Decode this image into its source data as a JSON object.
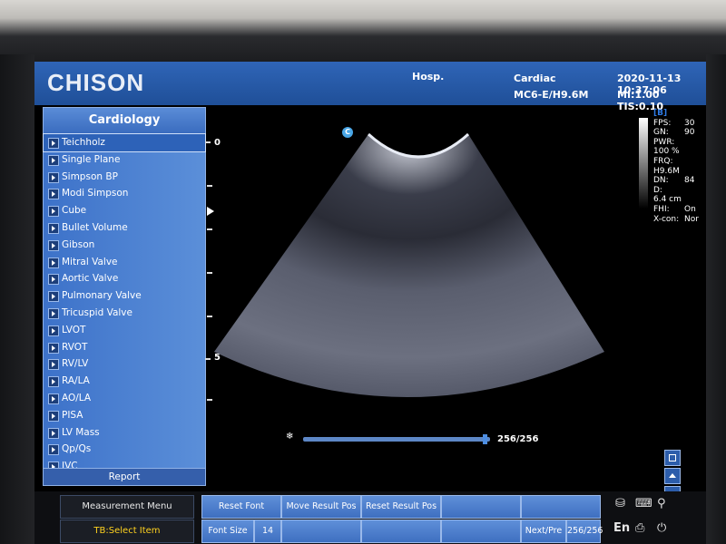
{
  "header": {
    "brand": "CHISON",
    "hospital": "Hosp.",
    "exam": "Cardiac",
    "probe_preset": "MC6-E/H9.6M",
    "datetime": "2020-11-13 10:37:06",
    "indices": "MI:1.00  TIS:0.10"
  },
  "menu": {
    "title": "Cardiology",
    "items": [
      {
        "label": "Teichholz"
      },
      {
        "label": "Single Plane"
      },
      {
        "label": "Simpson BP"
      },
      {
        "label": "Modi Simpson"
      },
      {
        "label": "Cube"
      },
      {
        "label": "Bullet Volume"
      },
      {
        "label": "Gibson"
      },
      {
        "label": "Mitral Valve"
      },
      {
        "label": "Aortic Valve"
      },
      {
        "label": "Pulmonary Valve"
      },
      {
        "label": "Tricuspid Valve"
      },
      {
        "label": "LVOT"
      },
      {
        "label": "RVOT"
      },
      {
        "label": "RV/LV"
      },
      {
        "label": "RA/LA"
      },
      {
        "label": "AO/LA"
      },
      {
        "label": "PISA"
      },
      {
        "label": "LV Mass"
      },
      {
        "label": "Qp/Qs"
      },
      {
        "label": "IVC"
      }
    ],
    "active_index": 0,
    "report_label": "Report"
  },
  "depth_scale": {
    "top_label": "0",
    "mid_label": "5"
  },
  "orientation_marker": "C",
  "imaging_params": {
    "mode": "[B]",
    "rows": [
      {
        "key": "FPS:",
        "value": "30"
      },
      {
        "key": "GN:",
        "value": "90"
      },
      {
        "key": "PWR:",
        "value": "100 %"
      },
      {
        "key": "FRQ:",
        "value": "H9.6M"
      },
      {
        "key": "DN:",
        "value": "84"
      },
      {
        "key": "D:",
        "value": "6.4 cm"
      },
      {
        "key": "FHI:",
        "value": "On"
      },
      {
        "key": "X-con:",
        "value": "Nor"
      }
    ]
  },
  "cine": {
    "count": "256/256",
    "position_fraction": 1.0
  },
  "bottom_bar": {
    "measurement_menu": "Measurement Menu",
    "tb_select": "TB:Select Item",
    "buttons_top": [
      "Reset Font",
      "Move Result Pos",
      "Reset Result Pos",
      "",
      ""
    ],
    "font_size_label": "Font Size",
    "font_size_value": "14",
    "buttons_bottom_blank": [
      "",
      ""
    ],
    "next_pre_label": "Next/Pre",
    "next_pre_value": "256/256",
    "lang": "En"
  },
  "colors": {
    "header_blue": "#2a5db0",
    "menu_blue": "#4a80d1",
    "tb_select_text": "#ffd21f",
    "mode_label": "#2f7be6"
  }
}
